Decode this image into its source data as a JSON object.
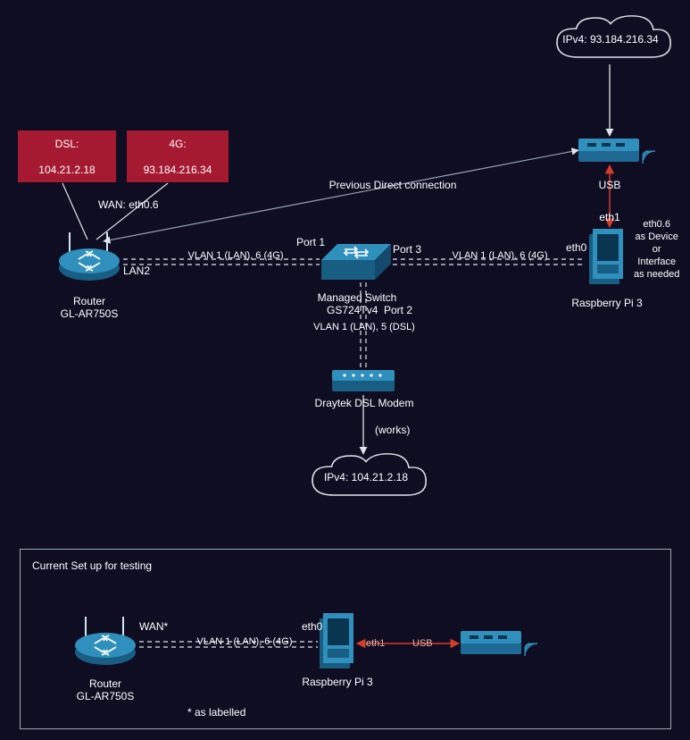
{
  "clouds": {
    "top": "IPv4: 93.184.216.34",
    "bottom": "IPv4: 104.21.2.18"
  },
  "red": {
    "dsl_title": "DSL:",
    "dsl_ip": "104.21.2.18",
    "g4_title": "4G:",
    "g4_ip": "93.184.216.34"
  },
  "router": {
    "name": "Router",
    "model": "GL-AR750S",
    "wan": "WAN: eth0.6",
    "lan2": "LAN2"
  },
  "switch": {
    "name": "Managed Switch",
    "model": "GS724Tv4",
    "p1": "Port 1",
    "p2": "Port 2",
    "p3": "Port 3"
  },
  "pi": {
    "name": "Raspberry Pi 3",
    "eth0": "eth0",
    "eth1": "eth1",
    "note": "eth0.6\nas Device\nor\nInterface\nas needed"
  },
  "usb": "USB",
  "links": {
    "vlan1_6": "VLAN 1 (LAN), 6 (4G)",
    "vlan1_5": "VLAN 1 (LAN), 5 (DSL)",
    "prev": "Previous Direct connection",
    "works": "(works)"
  },
  "modem": "Draytek DSL Modem",
  "panel": {
    "title": "Current Set up for testing",
    "wan": "WAN*",
    "note": "* as labelled",
    "eth0": "eth0",
    "eth1": "eth1",
    "usb": "USB",
    "vlan": "VLAN 1 (LAN), 6 (4G)",
    "router_name": "Router",
    "router_model": "GL-AR750S",
    "pi_name": "Raspberry Pi 3"
  },
  "chart_data": {
    "type": "network-diagram",
    "nodes": [
      {
        "id": "cloud-4g",
        "type": "cloud",
        "label": "IPv4: 93.184.216.34"
      },
      {
        "id": "dongle-4g",
        "type": "4g-dongle"
      },
      {
        "id": "pi",
        "type": "raspberry-pi",
        "label": "Raspberry Pi 3",
        "ports": [
          "eth0",
          "eth1"
        ],
        "note": "eth0.6 as Device or Interface as needed"
      },
      {
        "id": "switch",
        "type": "managed-switch",
        "label": "Managed Switch GS724Tv4",
        "ports": [
          "Port 1",
          "Port 2",
          "Port 3"
        ]
      },
      {
        "id": "router",
        "type": "router",
        "label": "Router GL-AR750S",
        "ports": [
          "WAN: eth0.6",
          "LAN2"
        ]
      },
      {
        "id": "modem",
        "type": "dsl-modem",
        "label": "Draytek DSL Modem"
      },
      {
        "id": "cloud-dsl",
        "type": "cloud",
        "label": "IPv4: 104.21.2.18"
      },
      {
        "id": "badge-dsl",
        "type": "badge",
        "title": "DSL:",
        "value": "104.21.2.18"
      },
      {
        "id": "badge-4g",
        "type": "badge",
        "title": "4G:",
        "value": "93.184.216.34"
      }
    ],
    "edges": [
      {
        "from": "cloud-4g",
        "to": "dongle-4g",
        "style": "solid-arrow"
      },
      {
        "from": "dongle-4g",
        "to": "pi",
        "via": "eth1",
        "label": "USB",
        "style": "solid-double-arrow",
        "color": "red"
      },
      {
        "from": "pi",
        "to": "switch",
        "via": "eth0/Port 3",
        "label": "VLAN 1 (LAN), 6 (4G)",
        "style": "dashed"
      },
      {
        "from": "switch",
        "to": "router",
        "via": "Port 1/LAN2",
        "label": "VLAN 1 (LAN), 6 (4G)",
        "style": "dashed"
      },
      {
        "from": "switch",
        "to": "modem",
        "via": "Port 2",
        "label": "VLAN 1 (LAN), 5 (DSL)",
        "style": "dashed"
      },
      {
        "from": "modem",
        "to": "cloud-dsl",
        "label": "(works)",
        "style": "solid-arrow"
      },
      {
        "from": "router",
        "to": "dongle-4g",
        "label": "Previous Direct connection",
        "style": "solid-long-arrow"
      },
      {
        "from": "badge-dsl",
        "to": "router",
        "style": "solid"
      },
      {
        "from": "badge-4g",
        "to": "router",
        "style": "solid"
      }
    ],
    "test_panel": {
      "title": "Current Set up for testing",
      "nodes": [
        {
          "id": "t-router",
          "type": "router",
          "label": "Router GL-AR750S",
          "ports": [
            "WAN*"
          ]
        },
        {
          "id": "t-pi",
          "type": "raspberry-pi",
          "label": "Raspberry Pi 3",
          "ports": [
            "eth0",
            "eth1"
          ]
        },
        {
          "id": "t-dongle",
          "type": "4g-dongle"
        }
      ],
      "edges": [
        {
          "from": "t-router",
          "to": "t-pi",
          "via": "WAN*/eth0",
          "label": "VLAN 1 (LAN), 6 (4G)",
          "style": "dashed"
        },
        {
          "from": "t-pi",
          "to": "t-dongle",
          "via": "eth1",
          "label": "USB",
          "style": "solid-double-arrow",
          "color": "red"
        }
      ],
      "note": "* as labelled"
    }
  }
}
